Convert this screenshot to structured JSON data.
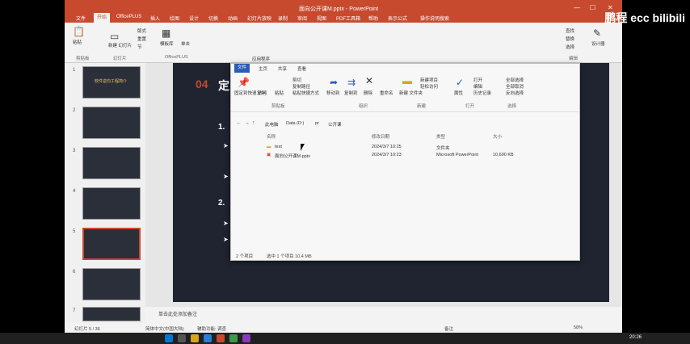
{
  "titlebar": {
    "title": "面向公开课M.pptx - PowerPoint",
    "min": "—",
    "max": "☐",
    "close": "✕"
  },
  "ribbon_tabs": [
    "文件",
    "开始",
    "OfficePLUS",
    "插入",
    "绘图",
    "设计",
    "切换",
    "动画",
    "幻灯片放映",
    "录制",
    "审阅",
    "视图",
    "PDF工具箱",
    "帮助",
    "表示公式",
    "操作说明搜索"
  ],
  "ribbon": {
    "paste": "粘贴",
    "new_slide": "新建\n幻灯片",
    "layout": "版式",
    "reset": "重置",
    "section": "节",
    "group_clipboard": "剪贴板",
    "group_slides": "幻灯片",
    "group_officeplus": "OfficePLUS",
    "group_editing": "编辑",
    "officeplus_btn": "模板库",
    "single": "单击",
    "designer": "设计器",
    "add_btn": "添加",
    "find": "查找",
    "replace": "替换",
    "select": "选择"
  },
  "watermark": "鹏程 ecc bilibili",
  "thumbs": [
    {
      "num": "1",
      "title": "软件逆向工程简介"
    },
    {
      "num": "2",
      "title": ""
    },
    {
      "num": "3",
      "title": ""
    },
    {
      "num": "4",
      "title": ""
    },
    {
      "num": "5",
      "title": ""
    },
    {
      "num": "6",
      "title": ""
    },
    {
      "num": "7",
      "title": ""
    }
  ],
  "slide": {
    "number": "04",
    "title": "定",
    "item1": "1.",
    "item2": "2.",
    "arrow": "➤"
  },
  "notes": "单击此处添加备注",
  "statusbar": {
    "slide_info": "幻灯片 5 / 36",
    "lang": "简体中文(中国大陆)",
    "accessibility": "辅助功能: 调查",
    "notes": "备注",
    "zoom": "58%"
  },
  "explorer": {
    "tabs": [
      "文件",
      "主页",
      "共享",
      "查看"
    ],
    "tab_top": "应用程序",
    "ribbon": {
      "pin": "固定到快速\n访问",
      "copy": "复制",
      "paste": "粘贴",
      "cut": "剪切",
      "copy_path": "复制路径",
      "paste_shortcut": "粘贴快捷方式",
      "move_to": "移动到",
      "copy_to": "复制到",
      "delete": "删除",
      "rename": "重命名",
      "new_folder": "新建\n文件夹",
      "new_item": "新建项目",
      "easy_access": "轻松访问",
      "properties": "属性",
      "open": "打开",
      "edit": "编辑",
      "history": "历史记录",
      "select_all": "全部选择",
      "select_none": "全部取消",
      "invert": "反向选择",
      "group_clipboard": "剪贴板",
      "group_organize": "组织",
      "group_new": "新建",
      "group_open": "打开",
      "group_select": "选择"
    },
    "breadcrumbs": [
      "此电脑",
      "Data (D:)",
      "pr",
      "公开课"
    ],
    "columns": [
      "名称",
      "修改日期",
      "类型",
      "大小"
    ],
    "rows": [
      {
        "name": "test",
        "date": "2024/3/7 10:25",
        "type": "文件夹",
        "size": ""
      },
      {
        "name": "面向公开课M.pptx",
        "date": "2024/3/7 10:23",
        "type": "Microsoft PowerPoint",
        "size": "10,690 KB"
      }
    ],
    "status": {
      "count": "2 个项目",
      "selected": "选中 1 个项目 10.4 MB"
    }
  },
  "taskbar": {
    "time": "20:26"
  }
}
